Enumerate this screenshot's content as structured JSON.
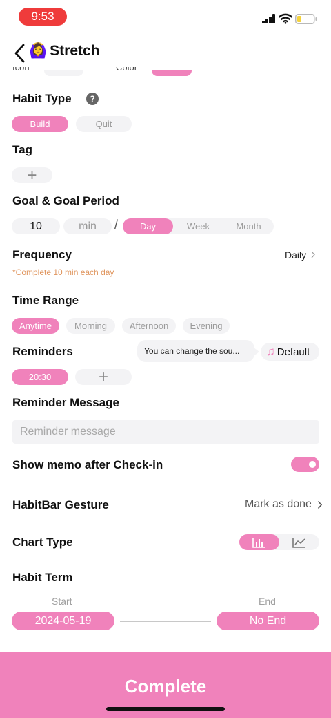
{
  "status_bar": {
    "time": "9:53"
  },
  "header": {
    "title_emoji": "🙆‍♀️",
    "title": "Stretch"
  },
  "cut_row": {
    "icon_label": "Icon",
    "color_label": "Color"
  },
  "habit_type": {
    "label": "Habit Type",
    "help": "?",
    "options": [
      "Build",
      "Quit"
    ],
    "selected": "Build"
  },
  "tag": {
    "label": "Tag",
    "add": "+"
  },
  "goal": {
    "label": "Goal & Goal Period",
    "value": "10",
    "unit": "min",
    "separator": "/",
    "periods": [
      "Day",
      "Week",
      "Month"
    ],
    "selected_period": "Day"
  },
  "frequency": {
    "label": "Frequency",
    "value": "Daily",
    "hint": "*Complete 10 min each day"
  },
  "time_range": {
    "label": "Time Range",
    "options": [
      "Anytime",
      "Morning",
      "Afternoon",
      "Evening"
    ],
    "selected": "Anytime"
  },
  "reminders": {
    "label": "Reminders",
    "tooltip": "You can change the sou...",
    "sound_icon": "♫",
    "sound": "Default",
    "times": [
      "20:30"
    ],
    "add": "+"
  },
  "reminder_message": {
    "label": "Reminder Message",
    "placeholder": "Reminder message"
  },
  "memo": {
    "label": "Show memo after Check-in",
    "enabled": true
  },
  "gesture": {
    "label": "HabitBar Gesture",
    "value": "Mark as done"
  },
  "chart_type": {
    "label": "Chart Type",
    "options": [
      "bar-chart-icon",
      "line-chart-icon"
    ],
    "selected": "bar-chart-icon"
  },
  "habit_term": {
    "label": "Habit Term",
    "start_label": "Start",
    "start": "2024-05-19",
    "end_label": "End",
    "end": "No End"
  },
  "footer": {
    "complete": "Complete"
  },
  "colors": {
    "accent": "#f082bb",
    "hint": "#e0965f",
    "time_pill": "#ef3b3b",
    "pill_bg": "#f3f3f5"
  }
}
